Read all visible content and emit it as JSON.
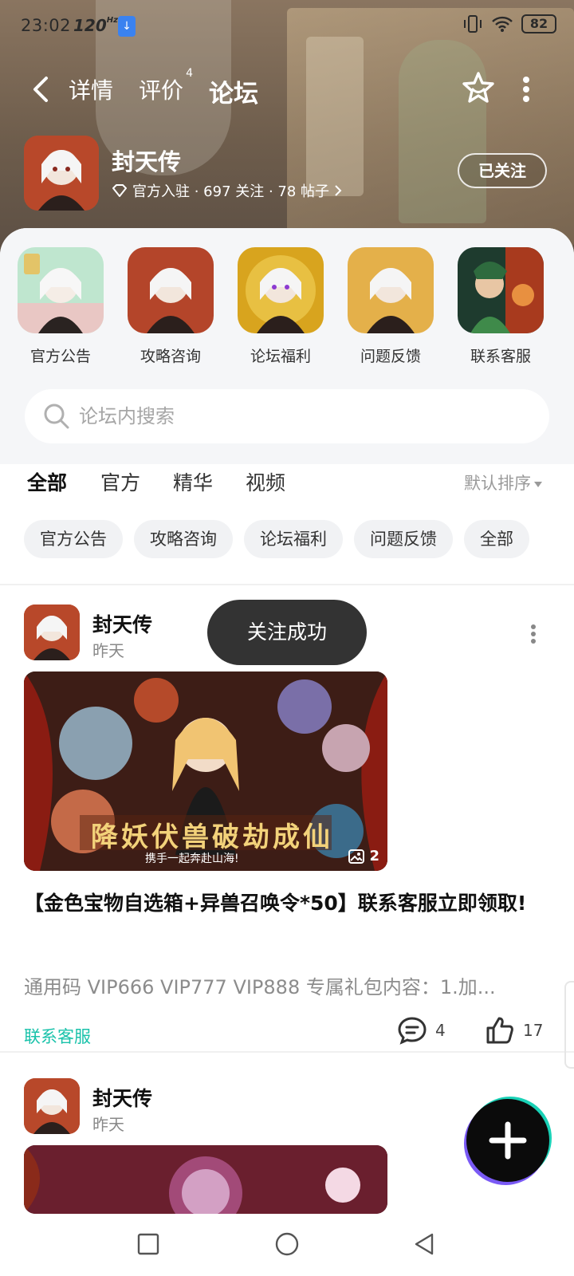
{
  "status_bar": {
    "time": "23:02",
    "refresh_rate": "120",
    "refresh_unit": "Hz",
    "battery": "82"
  },
  "nav": {
    "tabs": [
      {
        "label": "详情",
        "badge": ""
      },
      {
        "label": "评价",
        "badge": "4"
      },
      {
        "label": "论坛",
        "badge": ""
      }
    ],
    "active_tab": "论坛"
  },
  "game": {
    "name": "封天传",
    "meta": "官方入驻 · 697 关注 · 78 帖子",
    "follow_label": "已关注"
  },
  "shortcuts": [
    {
      "label": "官方公告"
    },
    {
      "label": "攻略咨询"
    },
    {
      "label": "论坛福利"
    },
    {
      "label": "问题反馈"
    },
    {
      "label": "联系客服"
    }
  ],
  "search": {
    "placeholder": "论坛内搜索"
  },
  "filter_tabs": [
    {
      "label": "全部"
    },
    {
      "label": "官方"
    },
    {
      "label": "精华"
    },
    {
      "label": "视频"
    }
  ],
  "sort_label": "默认排序",
  "chips": [
    {
      "label": "官方公告"
    },
    {
      "label": "攻略咨询"
    },
    {
      "label": "论坛福利"
    },
    {
      "label": "问题反馈"
    },
    {
      "label": "全部"
    }
  ],
  "posts": [
    {
      "author": "封天传",
      "time": "昨天",
      "image_count": "2",
      "cover_text": "降妖伏兽破劫成仙",
      "cover_subtext": "携手一起奔赴山海!",
      "title": "【金色宝物自选箱+异兽召唤令*50】联系客服立即领取!",
      "excerpt": "通用码 VIP666 VIP777 VIP888 专属礼包内容：1.加...",
      "tag": "联系客服",
      "comments": "4",
      "likes": "17"
    },
    {
      "author": "封天传",
      "time": "昨天"
    }
  ],
  "toast": "关注成功",
  "colors": {
    "accent": "#19d1b6",
    "tag": "#19c2aa",
    "toast_bg": "#333333"
  }
}
